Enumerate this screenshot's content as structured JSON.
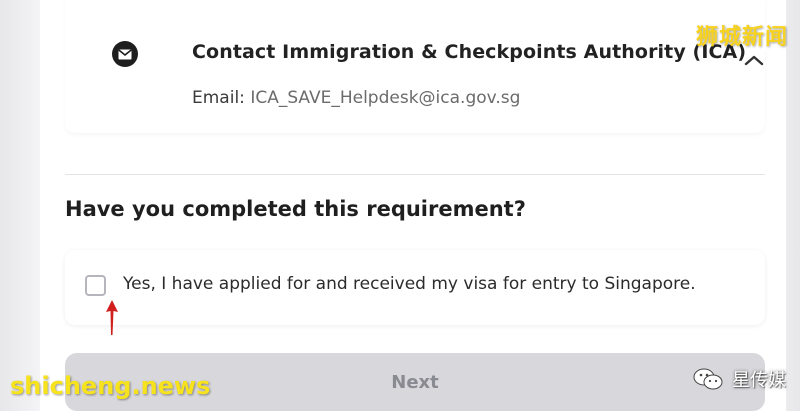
{
  "contact": {
    "title": "Contact Immigration & Checkpoints Authority (ICA)",
    "email_label": "Email:",
    "email_value": "ICA_SAVE_Helpdesk@ica.gov.sg",
    "icon": "mail-icon",
    "collapse_icon": "chevron-up-icon"
  },
  "requirement": {
    "question": "Have you completed this requirement?",
    "checkbox_label": "Yes, I have applied for and received my visa for entry to Singapore.",
    "checked": false
  },
  "actions": {
    "next_label": "Next",
    "next_enabled": false
  },
  "watermarks": {
    "top_right": "狮城新闻",
    "bottom_left": "shicheng.news",
    "bottom_right": "星传媒"
  },
  "colors": {
    "annotation_arrow": "#d0201e",
    "watermark_yellow": "#f7d21e",
    "button_disabled_bg": "#d8d8dc"
  }
}
